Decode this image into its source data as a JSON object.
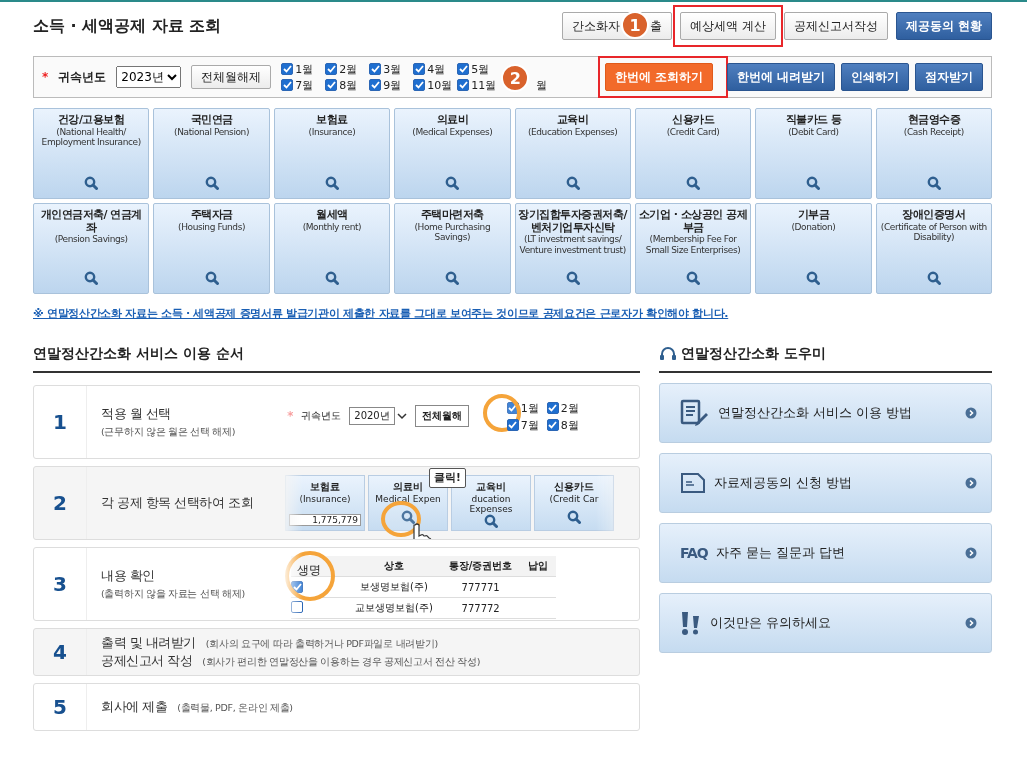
{
  "header": {
    "title": "소득 · 세액공제 자료 조회",
    "badge": "1",
    "buttons": [
      {
        "label": "간소화자",
        "label_after": "출",
        "kind": "plain",
        "highlighted": false
      },
      {
        "label": "예상세액 계산",
        "kind": "plain",
        "highlighted": true
      },
      {
        "label": "공제신고서작성",
        "kind": "plain",
        "highlighted": false
      },
      {
        "label": "제공동의 현황",
        "kind": "primary",
        "highlighted": false
      }
    ]
  },
  "filter": {
    "required_mark": "*",
    "year_label": "귀속년도",
    "year": "2023년",
    "clear_button": "전체월해제",
    "months": [
      {
        "label": "1월",
        "checked": true
      },
      {
        "label": "2월",
        "checked": true
      },
      {
        "label": "3월",
        "checked": true
      },
      {
        "label": "4월",
        "checked": true
      },
      {
        "label": "5월",
        "checked": true
      },
      {
        "badge": "2"
      },
      {
        "label": "7월",
        "checked": true
      },
      {
        "label": "8월",
        "checked": true
      },
      {
        "label": "9월",
        "checked": true
      },
      {
        "label": "10월",
        "checked": true
      },
      {
        "label": "11월",
        "checked": true
      },
      {
        "label": "월"
      }
    ],
    "buttons": [
      {
        "label": "한번에 조회하기",
        "kind": "orange",
        "highlighted": true
      },
      {
        "label": "한번에 내려받기",
        "kind": "primary",
        "highlighted": false
      },
      {
        "label": "인쇄하기",
        "kind": "primary",
        "highlighted": false
      },
      {
        "label": "점자받기",
        "kind": "primary",
        "highlighted": false
      }
    ]
  },
  "categories": [
    {
      "title": "건강/고용보험",
      "subtitle": "(National Health/ Employment Insurance)"
    },
    {
      "title": "국민연금",
      "subtitle": "(National Pension)"
    },
    {
      "title": "보험료",
      "subtitle": "(Insurance)"
    },
    {
      "title": "의료비",
      "subtitle": "(Medical Expenses)"
    },
    {
      "title": "교육비",
      "subtitle": "(Education Expenses)"
    },
    {
      "title": "신용카드",
      "subtitle": "(Credit Card)"
    },
    {
      "title": "직불카드 등",
      "subtitle": "(Debit Card)"
    },
    {
      "title": "현금영수증",
      "subtitle": "(Cash Receipt)"
    },
    {
      "title": "개인연금저축/ 연금계좌",
      "subtitle": "(Pension Savings)"
    },
    {
      "title": "주택자금",
      "subtitle": "(Housing Funds)"
    },
    {
      "title": "월세액",
      "subtitle": "(Monthly rent)"
    },
    {
      "title": "주택마련저축",
      "subtitle": "(Home Purchasing Savings)"
    },
    {
      "title": "장기집합투자증권저축/ 벤처기업투자신탁",
      "subtitle": "(LT investment savings/ Venture investment trust)"
    },
    {
      "title": "소기업 · 소상공인 공제부금",
      "subtitle": "(Membership Fee For Small Size Enterprises)"
    },
    {
      "title": "기부금",
      "subtitle": "(Donation)"
    },
    {
      "title": "장애인증명서",
      "subtitle": "(Certificate of Person with Disability)"
    }
  ],
  "notice": "※ 연말정산간소화 자료는 소득 · 세액공제 증명서류 발급기관이 제출한 자료를 그대로 보여주는 것이므로 공제요건은 근로자가 확인해야 합니다.",
  "steps_title": "연말정산간소화 서비스 이용 순서",
  "steps": [
    {
      "number": "1",
      "lines": [
        {
          "title": "적용 월 선택",
          "note": "(근무하지 않은 월은 선택 해제)"
        }
      ],
      "preview": {
        "kind": "months",
        "required_mark": "*",
        "year_label": "귀속년도",
        "year": "2020년",
        "button": "전체월해",
        "months": [
          {
            "label": "1월",
            "checked": true
          },
          {
            "label": "2월",
            "checked": true
          },
          {
            "label": "7월",
            "checked": true
          },
          {
            "label": "8월",
            "checked": true
          }
        ]
      }
    },
    {
      "number": "2",
      "lines": [
        {
          "title": "각 공제 항목 선택하여 조회"
        }
      ],
      "preview": {
        "kind": "tiles",
        "tooltip": "클릭!",
        "tiles": [
          {
            "title": "보험료",
            "subtitle": "(Insurance)",
            "value": "1,775,779"
          },
          {
            "title": "의료비",
            "subtitle": "Medical Expen"
          },
          {
            "title": "교육비",
            "subtitle": "ducation Expenses"
          },
          {
            "title": "신용카드",
            "subtitle": "(Credit Car"
          }
        ]
      }
    },
    {
      "number": "3",
      "lines": [
        {
          "title": "내용 확인",
          "note": "(출력하지 않을 자료는 선택 해제)"
        }
      ],
      "preview": {
        "kind": "table",
        "columns": [
          "상호",
          "통장/증권번호",
          "납입"
        ],
        "zoomed": "생명",
        "rows": [
          {
            "name": "보생명보험(주)",
            "number": "777771",
            "checked": true
          },
          {
            "name": "교보생명보험(주)",
            "number": "777772",
            "checked": false
          }
        ]
      }
    },
    {
      "number": "4",
      "lines": [
        {
          "title": "출력 및 내려받기",
          "note": "(회사의 요구에 따라 출력하거나 PDF파일로 내려받기)"
        },
        {
          "title": "공제신고서 작성",
          "note": "(회사가 편리한 연말정산을 이용하는 경우 공제신고서 전산 작성)"
        }
      ]
    },
    {
      "number": "5",
      "lines": [
        {
          "title": "회사에 제출",
          "note": "(출력물, PDF, 온라인 제출)"
        }
      ]
    }
  ],
  "helper": {
    "title": "연말정산간소화 도우미",
    "items": [
      {
        "label": "연말정산간소화 서비스 이용 방법",
        "kind": "manual"
      },
      {
        "label": "자료제공동의 신청 방법",
        "kind": "document"
      },
      {
        "label": "자주 묻는 질문과 답변",
        "kind": "faq",
        "icon_text": "FAQ"
      },
      {
        "label": "이것만은 유의하세요",
        "kind": "warning"
      }
    ]
  }
}
